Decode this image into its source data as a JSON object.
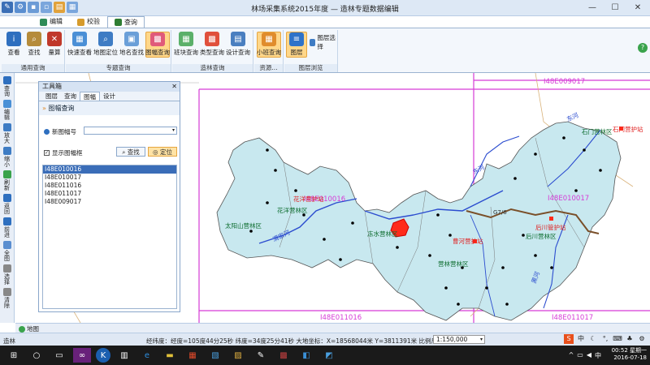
{
  "title": "林场采集系统2015年度 — 造林专题数据编辑",
  "tabs": [
    "编辑",
    "校验",
    "查询"
  ],
  "ribbon": {
    "groups": [
      {
        "title": "通用查询",
        "buttons": [
          "查看",
          "查找",
          "量算"
        ]
      },
      {
        "title": "专题查询",
        "buttons": [
          "快速查看",
          "地图定位",
          "地名查找",
          "图幅查询"
        ]
      },
      {
        "title": "造林查询",
        "buttons": [
          "班块查询",
          "类型查询",
          "设计查询"
        ]
      },
      {
        "title": "资源...",
        "buttons": [
          "小班查询"
        ]
      },
      {
        "title": "图层浏览",
        "buttons": [
          "图层",
          "图层选择"
        ]
      }
    ]
  },
  "sidebar": [
    "查询",
    "编辑",
    "放大",
    "缩小",
    "刷新",
    "返回",
    "前进",
    "全图",
    "选择",
    "清除"
  ],
  "toolbox": {
    "title": "工具箱",
    "tabs": [
      "图层",
      "查询",
      "图幅",
      "设计"
    ],
    "section": "图幅查询",
    "map_no_label": "新图幅号",
    "show_frame_label": "显示图幅框",
    "find_label": "查找",
    "locate_label": "定位",
    "list": [
      "I48E010016",
      "I48E010017",
      "I48E011016",
      "I48E011017",
      "I48E009017"
    ],
    "selected_index": 0
  },
  "map": {
    "grid_labels": [
      "I48E009017",
      "I48E010016",
      "I48E010017",
      "I48E011016",
      "I48E011017"
    ],
    "regions": [
      "太阳山营林区",
      "花洋营林区",
      "冻水营林区",
      "营林营林区",
      "石门营林区",
      "后川营林区"
    ],
    "stations": [
      "花洋营护站",
      "曹河营护站",
      "石门营护站",
      "后川管护站"
    ],
    "rivers": [
      "渭家河",
      "东河",
      "黑河",
      "东河"
    ],
    "road": "G7/6"
  },
  "map_tab": "地图",
  "status": {
    "user": "造林",
    "coords": "经纬度：经度=105度44分25秒  纬度=34度25分41秒   大地坐标：X=18568044米  Y=3811391米   比例尺",
    "scale": "1:150,000"
  },
  "tray": {
    "time": "00:52 星期一",
    "date": "2016-07-18",
    "ime": "中"
  }
}
